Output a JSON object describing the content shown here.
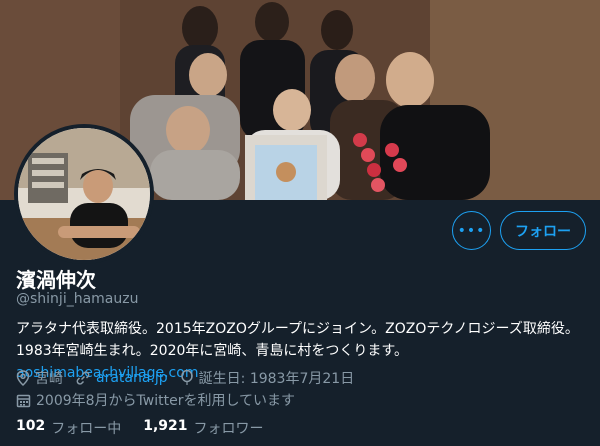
{
  "profile": {
    "display_name": "濱渦伸次",
    "handle": "@shinji_hamauzu",
    "bio_line1": "アラタナ代表取締役。2015年ZOZOグループにジョイン。ZOZOテクノロジーズ取締役。",
    "bio_line2_text": "1983年宮崎生まれ。2020年に宮崎、青島に村をつくります。",
    "bio_line2_link": "aoshimabeachvillage.com",
    "location": "宮崎",
    "website": "aratana.jp",
    "birthday": "誕生日: 1983年7月21日",
    "joined": "2009年8月からTwitterを利用しています"
  },
  "actions": {
    "more_label": "•••",
    "follow_label": "フォロー"
  },
  "stats": {
    "following_count": "102",
    "following_label": "フォロー中",
    "followers_count": "1,921",
    "followers_label": "フォロワー"
  },
  "icons": {
    "location": "location-pin-icon",
    "link": "link-icon",
    "birthday": "balloon-icon",
    "calendar": "calendar-icon"
  },
  "colors": {
    "background": "#15202b",
    "accent": "#1da1f2",
    "secondary_text": "#8899a6"
  }
}
